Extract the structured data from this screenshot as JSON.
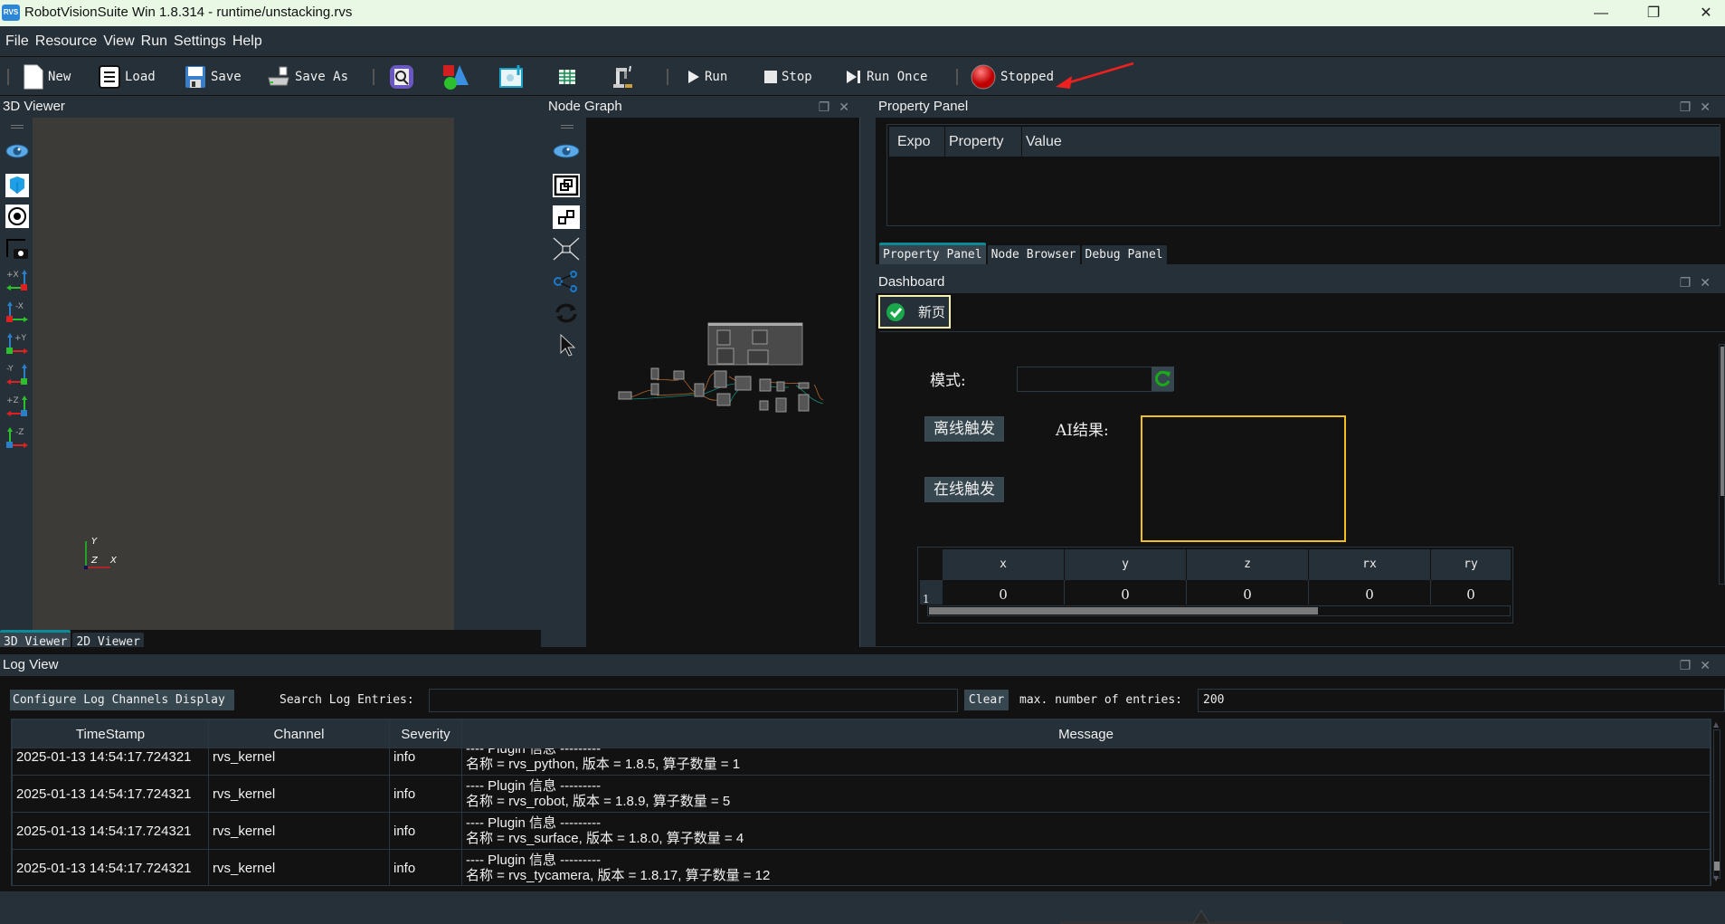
{
  "window": {
    "logo_text": "RVS",
    "title": "RobotVisionSuite Win 1.8.314 - runtime/unstacking.rvs",
    "minimize": "—",
    "restore": "❐",
    "close": "✕"
  },
  "menu": [
    "File",
    "Resource",
    "View",
    "Run",
    "Settings",
    "Help"
  ],
  "toolbar": {
    "new": "New",
    "load": "Load",
    "save": "Save",
    "save_as": "Save As",
    "run": "Run",
    "stop": "Stop",
    "run_once": "Run Once",
    "status": "Stopped",
    "status_color": "#e02020"
  },
  "viewer3d": {
    "title": "3D Viewer",
    "tools": [
      "eye",
      "cube-view",
      "target",
      "screenshot",
      "+X",
      "-X",
      "+Y",
      "-Y",
      "+Z",
      "-Z"
    ],
    "axis": {
      "y": "Y",
      "z": "Z",
      "x": "X"
    },
    "tabs": [
      "3D Viewer",
      "2D Viewer"
    ],
    "active_tab": "3D Viewer"
  },
  "node_graph": {
    "title": "Node Graph",
    "tools": [
      "eye",
      "group",
      "ungroup",
      "fit",
      "connect",
      "refresh",
      "select"
    ]
  },
  "property_panel": {
    "title": "Property Panel",
    "columns": [
      "Expo",
      "Property",
      "Value"
    ],
    "tabs": [
      "Property Panel",
      "Node Browser",
      "Debug Panel"
    ],
    "active_tab": "Property Panel"
  },
  "dashboard": {
    "title": "Dashboard",
    "page_tab": "新页",
    "mode_label": "模式:",
    "mode_value": "",
    "offline_button": "离线触发",
    "online_button": "在线触发",
    "ai_result_label": "AI结果:",
    "ai_result_value": "",
    "table": {
      "columns": [
        "x",
        "y",
        "z",
        "rx",
        "ry"
      ],
      "rows": [
        {
          "index": "1",
          "values": [
            "0",
            "0",
            "0",
            "0",
            "0"
          ]
        }
      ]
    }
  },
  "log_view": {
    "title": "Log View",
    "configure_button": "Configure Log Channels Display",
    "search_label": "Search Log Entries:",
    "search_value": "",
    "clear_button": "Clear",
    "max_label": "max. number of entries:",
    "max_value": "200",
    "columns": [
      "TimeStamp",
      "Channel",
      "Severity",
      "Message"
    ],
    "rows": [
      {
        "timestamp": "2025-01-13 14:54:17.724321",
        "channel": "rvs_kernel",
        "severity": "info",
        "line1": "---- Plugin 信息 ---------",
        "line2": "名称 = rvs_python,  版本 = 1.8.5,  算子数量 = 1"
      },
      {
        "timestamp": "2025-01-13 14:54:17.724321",
        "channel": "rvs_kernel",
        "severity": "info",
        "line1": "---- Plugin 信息 ---------",
        "line2": "名称 = rvs_robot,  版本 = 1.8.9,  算子数量 = 5"
      },
      {
        "timestamp": "2025-01-13 14:54:17.724321",
        "channel": "rvs_kernel",
        "severity": "info",
        "line1": "---- Plugin 信息 ---------",
        "line2": "名称 = rvs_surface,  版本 = 1.8.0,  算子数量 = 4"
      },
      {
        "timestamp": "2025-01-13 14:54:17.724321",
        "channel": "rvs_kernel",
        "severity": "info",
        "line1": "---- Plugin 信息 ---------",
        "line2": "名称 = rvs_tycamera,  版本 = 1.8.17,  算子数量 = 12"
      }
    ]
  }
}
